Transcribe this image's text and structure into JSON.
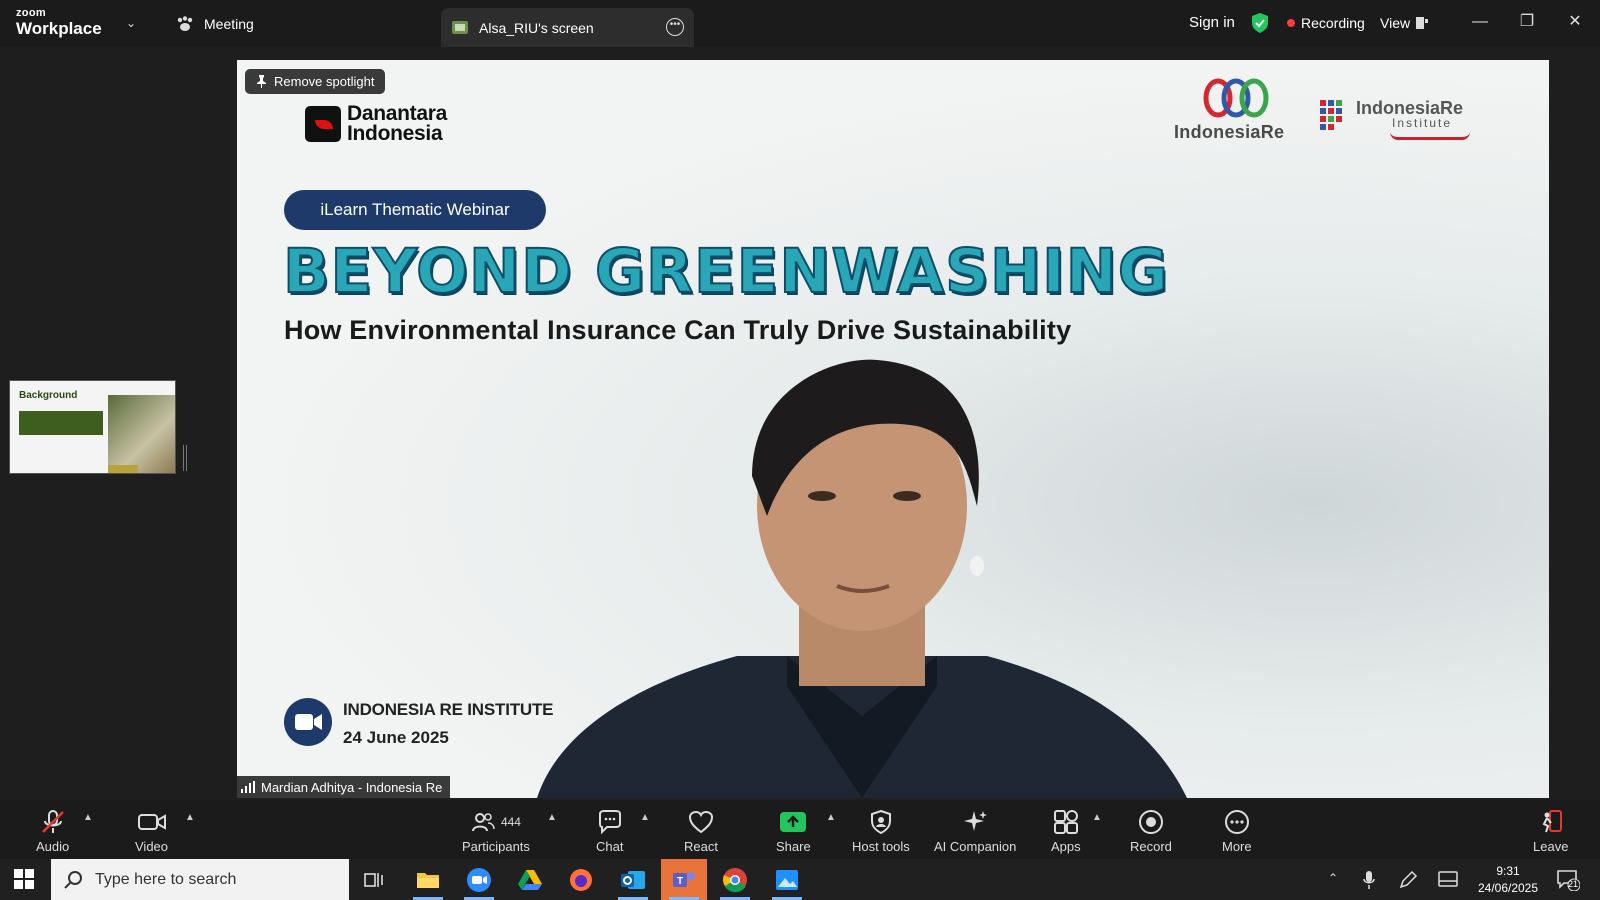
{
  "titlebar": {
    "brand_top": "zoom",
    "brand_bottom": "Workplace",
    "meeting_tab": "Meeting",
    "screen_tab": "Alsa_RIU's screen",
    "sign_in": "Sign in",
    "recording": "Recording",
    "view": "View"
  },
  "thumbnail": {
    "title": "Background"
  },
  "video": {
    "spotlight": "Remove spotlight",
    "danantara_line1": "Danantara",
    "danantara_line2": "Indonesia",
    "indonesiare_logo": "IndonesiaRe",
    "institute_name": "IndonesiaRe",
    "institute_sub": "Institute",
    "badge": "iLearn Thematic Webinar",
    "headline": "BEYOND GREENWASHING",
    "subheadline": "How Environmental Insurance Can Truly Drive Sustainability",
    "organizer": "INDONESIA RE INSTITUTE",
    "date": "24 June 2025",
    "participant_name": "Mardian Adhitya - Indonesia Re"
  },
  "toolbar": {
    "audio": "Audio",
    "video": "Video",
    "participants": "Participants",
    "participants_count": "444",
    "chat": "Chat",
    "react": "React",
    "share": "Share",
    "host_tools": "Host tools",
    "ai_companion": "AI Companion",
    "apps": "Apps",
    "record": "Record",
    "more": "More",
    "leave": "Leave"
  },
  "taskbar": {
    "search_placeholder": "Type here to search",
    "time": "9:31",
    "date": "24/06/2025",
    "notifications": "21"
  },
  "colors": {
    "headline_teal": "#2aa7b7",
    "badge_navy": "#1e3a6b",
    "recording_red": "#ff3b3b",
    "share_green": "#22c55e"
  }
}
